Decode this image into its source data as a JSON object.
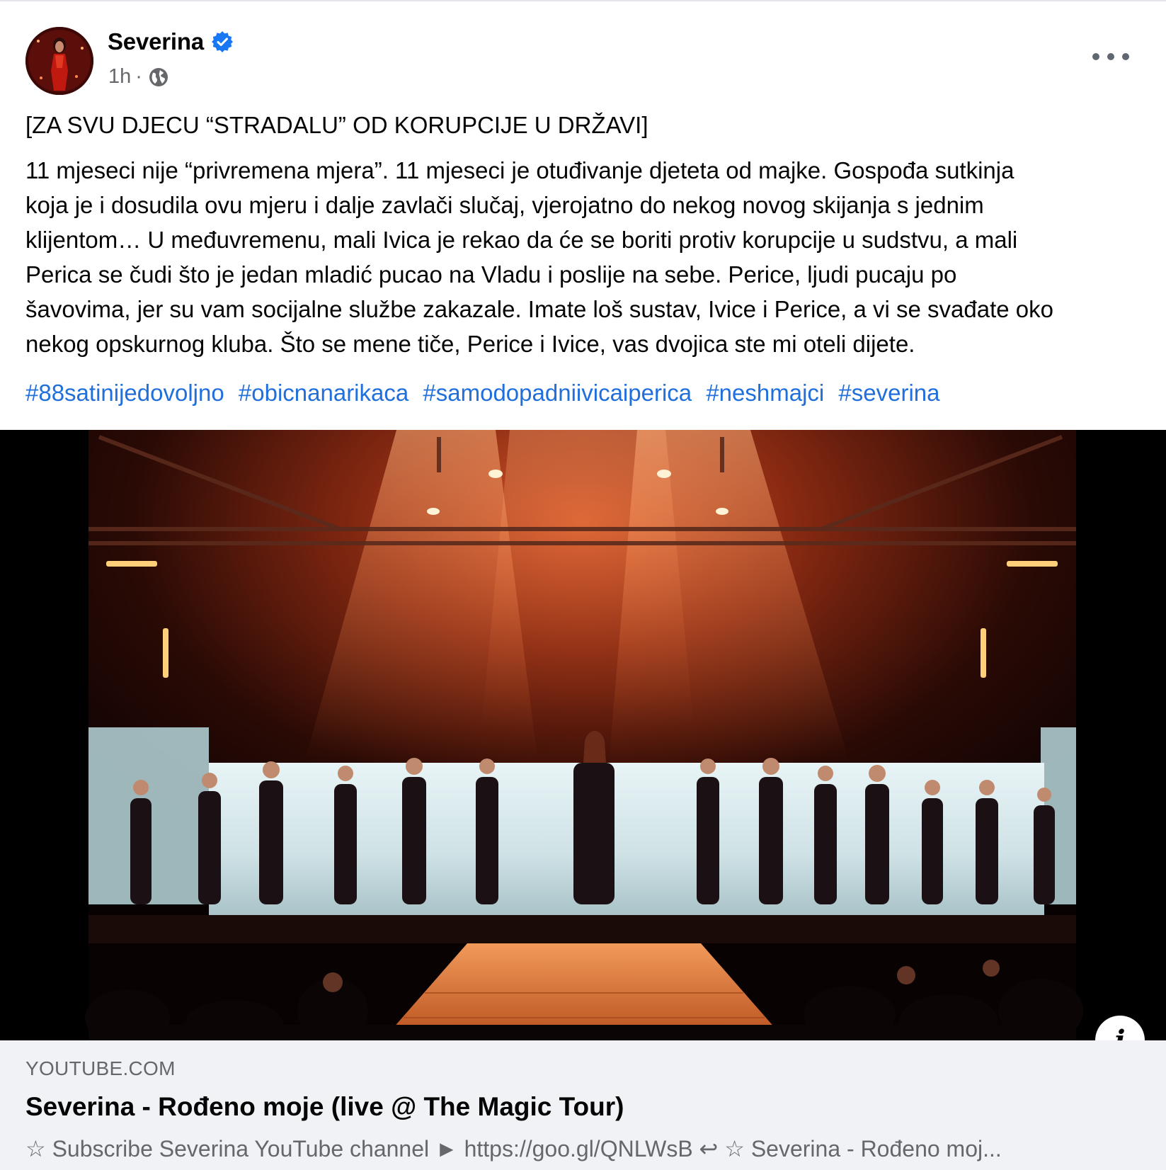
{
  "post": {
    "author": "Severina",
    "time": "1h",
    "separator": "·",
    "headline": "[ZA SVU DJECU “STRADALU” OD KORUPCIJE U DRŽAVI]",
    "body_lines": [
      "11 mjeseci nije “privremena mjera”. 11 mjeseci je otuđivanje djeteta od majke. Gospođa sutkinja",
      "koja je i dosudila ovu mjeru i dalje zavlači slučaj, vjerojatno do nekog novog skijanja s jednim",
      "klijentom… U međuvremenu, mali Ivica je rekao da će se boriti protiv korupcije u sudstvu, a mali",
      "Perica se čudi što je jedan mladić pucao na Vladu i poslije na sebe. Perice, ljudi pucaju po",
      "šavovima, jer su vam socijalne službe zakazale. Imate loš sustav, Ivice i Perice, a vi se svađate oko",
      "nekog opskurnog kluba. Što se mene tiče, Perice i Ivice, vas dvojica ste mi oteli dijete."
    ],
    "hashtags": [
      "#88satinijedovoljno",
      "#obicnanarikaca",
      "#samodopadniivicaiperica",
      "#neshmajci",
      "#severina"
    ]
  },
  "link": {
    "domain": "YOUTUBE.COM",
    "title": "Severina - Rođeno moje (live @ The Magic Tour)",
    "description": "☆ Subscribe Severina YouTube channel ► https://goo.gl/QNLWsB ↩ ☆ Severina - Rođeno moj..."
  },
  "icons": {
    "verified": "verified-badge-icon",
    "privacy": "globe-icon",
    "more": "more-options-icon",
    "info": "info-icon"
  },
  "colors": {
    "hashtag": "#216fdb",
    "verified": "#1877f2",
    "secondary_text": "#65676b",
    "link_box_bg": "#f0f2f5"
  }
}
